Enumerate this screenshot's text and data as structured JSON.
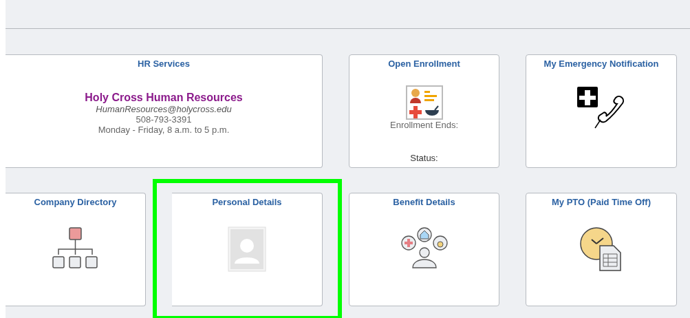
{
  "tiles": [
    {
      "title": "HR Services",
      "kind": "contact",
      "highlighted": false,
      "organization": "Holy Cross Human Resources",
      "email": "HumanResources@holycross.edu",
      "phone": "508-793-3391",
      "hours": "Monday - Friday, 8 a.m. to 5 p.m."
    },
    {
      "title": "Open Enrollment",
      "kind": "enrollment",
      "highlighted": false,
      "ends_label": "Enrollment Ends:",
      "status_label": "Status:"
    },
    {
      "title": "My Emergency Notification",
      "kind": "emergency",
      "highlighted": false
    },
    {
      "title": "Company Directory",
      "kind": "directory",
      "highlighted": false
    },
    {
      "title": "Personal Details",
      "kind": "person",
      "highlighted": true
    },
    {
      "title": "Benefit Details",
      "kind": "benefits",
      "highlighted": false
    },
    {
      "title": "My PTO (Paid Time Off)",
      "kind": "pto",
      "highlighted": false
    }
  ]
}
